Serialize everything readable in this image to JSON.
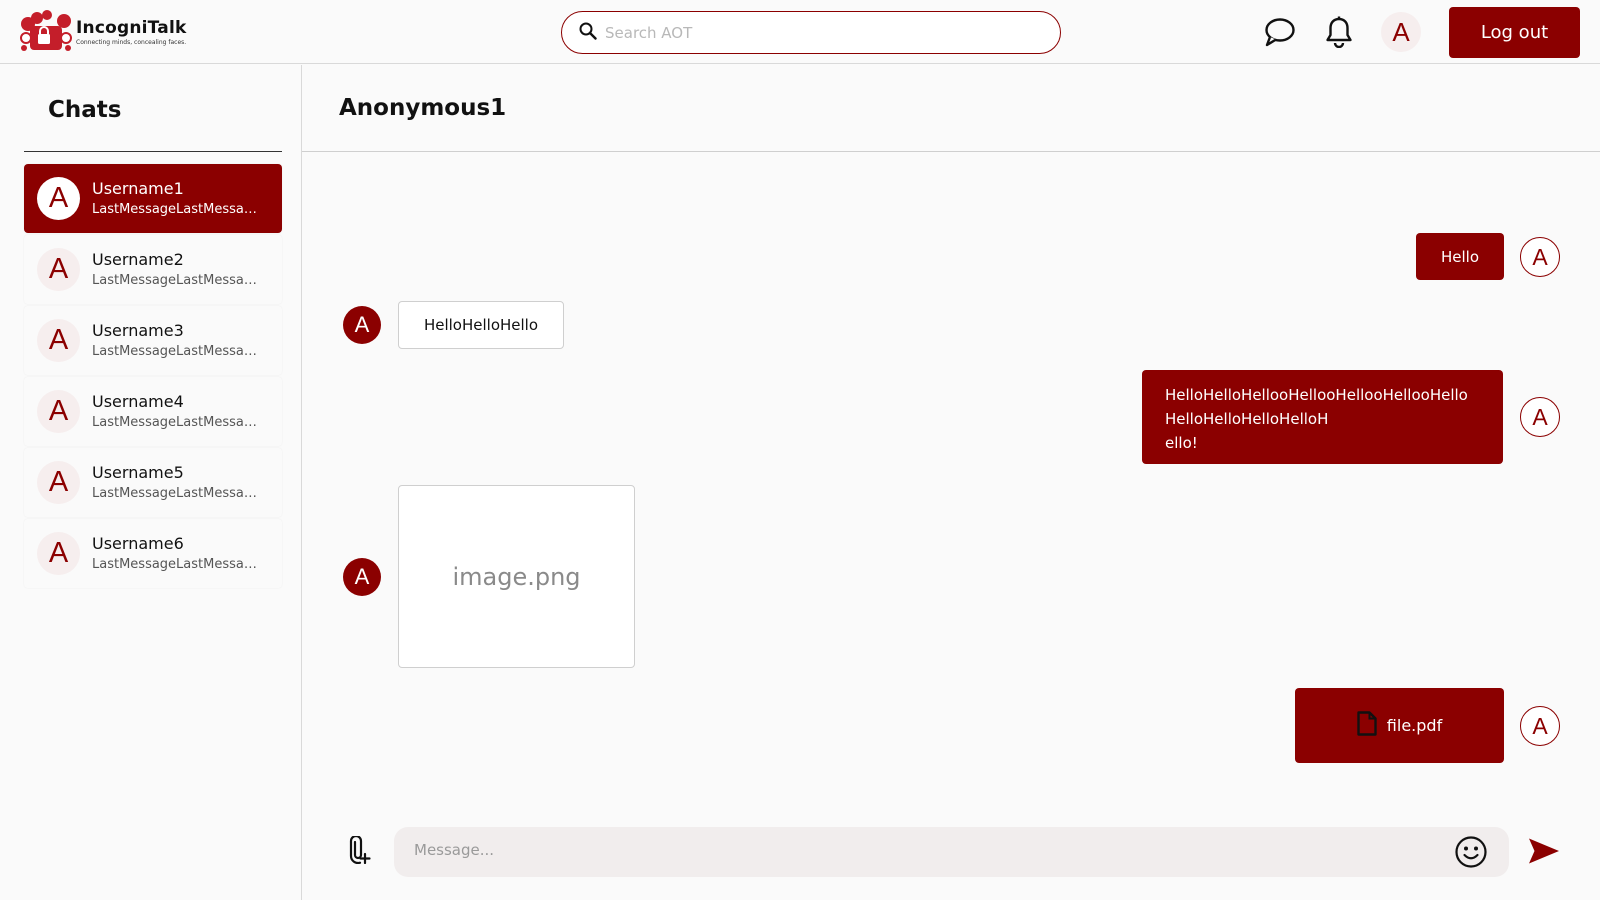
{
  "header": {
    "app_name": "IncogniTalk",
    "tagline": "Connecting minds, concealing faces.",
    "search_placeholder": "Search AOT",
    "avatar_letter": "A",
    "logout_label": "Log out",
    "icons": [
      "search-icon",
      "chat-icon",
      "bell-icon"
    ]
  },
  "sidebar": {
    "title": "Chats",
    "items": [
      {
        "avatar": "A",
        "name": "Username1",
        "last": "LastMessageLastMessage",
        "active": true
      },
      {
        "avatar": "A",
        "name": "Username2",
        "last": "LastMessageLastMessage",
        "active": false
      },
      {
        "avatar": "A",
        "name": "Username3",
        "last": "LastMessageLastMessage",
        "active": false
      },
      {
        "avatar": "A",
        "name": "Username4",
        "last": "LastMessageLastMessage",
        "active": false
      },
      {
        "avatar": "A",
        "name": "Username5",
        "last": "LastMessageLastMessage",
        "active": false
      },
      {
        "avatar": "A",
        "name": "Username6",
        "last": "LastMessageLastMessage",
        "active": false
      }
    ]
  },
  "conversation": {
    "title": "Anonymous1",
    "messages": [
      {
        "direction": "outgoing",
        "type": "text",
        "avatar": "A",
        "text": "Hello"
      },
      {
        "direction": "incoming",
        "type": "text",
        "avatar": "A",
        "text": "HelloHelloHello"
      },
      {
        "direction": "outgoing",
        "type": "text",
        "avatar": "A",
        "text": "HelloHelloHellooHellooHellooHellooHello\nHelloHelloHelloHelloH\nello!"
      },
      {
        "direction": "incoming",
        "type": "image",
        "avatar": "A",
        "text": "image.png"
      },
      {
        "direction": "outgoing",
        "type": "file",
        "avatar": "A",
        "text": "file.pdf",
        "icon": "file-icon"
      }
    ]
  },
  "composer": {
    "placeholder": "Message...",
    "icons": [
      "attach-icon",
      "emoji-icon",
      "send-icon"
    ]
  },
  "colors": {
    "accent": "#8B0000",
    "background": "#FAFAFA",
    "composer_bg": "#F1EDED",
    "avatar_bg": "#F6EEEE"
  }
}
